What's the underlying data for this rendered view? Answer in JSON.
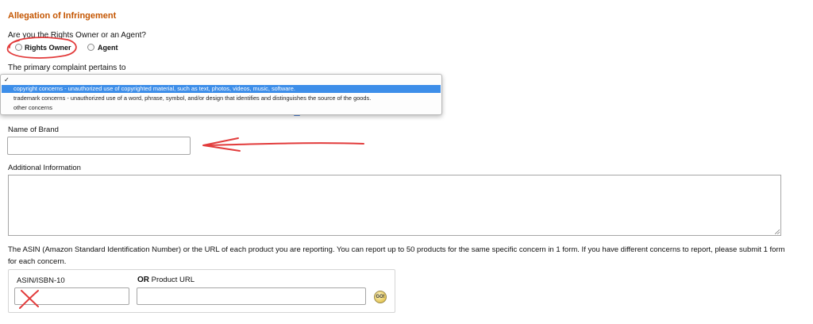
{
  "section": {
    "title": "Allegation of Infringement"
  },
  "role_question": {
    "label": "Are you the Rights Owner or an Agent?",
    "options": [
      "Rights Owner",
      "Agent"
    ]
  },
  "complaint": {
    "label": "The primary complaint pertains to",
    "checkmark": "✓",
    "options": [
      "copyright concerns - unauthorized use of copyrighted material, such as text, photos, videos, music, software.",
      "trademark concerns - unauthorized use of a word, phrase, symbol, and/or design that identifies and distinguishes the source of the goods.",
      "other concerns"
    ],
    "selected_index": 0
  },
  "brand": {
    "label": "Name of Brand",
    "value": ""
  },
  "additional": {
    "label": "Additional Information",
    "value": ""
  },
  "asin_info": {
    "text": "The ASIN (Amazon Standard Identification Number) or the URL of each product you are reporting. You can report up to 50 products for the same specific concern in 1 form. If you have different concerns to report, please submit 1 form for each concern."
  },
  "asin_box": {
    "asin_label": "ASIN/ISBN-10",
    "or_label": "OR",
    "url_label": "Product URL",
    "go_label": "GO!"
  },
  "annotations": {
    "color": "#e23b3b"
  },
  "colors": {
    "section_title": "#c45500",
    "dropdown_highlight": "#3d8ee9"
  }
}
